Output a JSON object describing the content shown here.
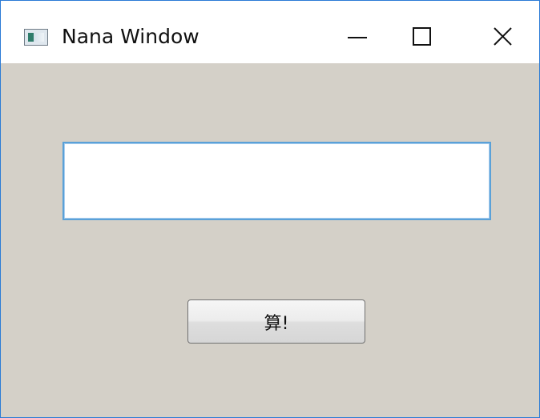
{
  "window": {
    "title": "Nana Window",
    "icon": "app-window-icon",
    "controls": {
      "minimize_icon": "minimize-icon",
      "maximize_icon": "maximize-icon",
      "close_icon": "close-icon"
    }
  },
  "form": {
    "input_value": "",
    "button_label": "算!"
  },
  "colors": {
    "window_border": "#2b7bd6",
    "client_background": "#d4d0c8",
    "input_focus_border": "#5aa1d8"
  }
}
